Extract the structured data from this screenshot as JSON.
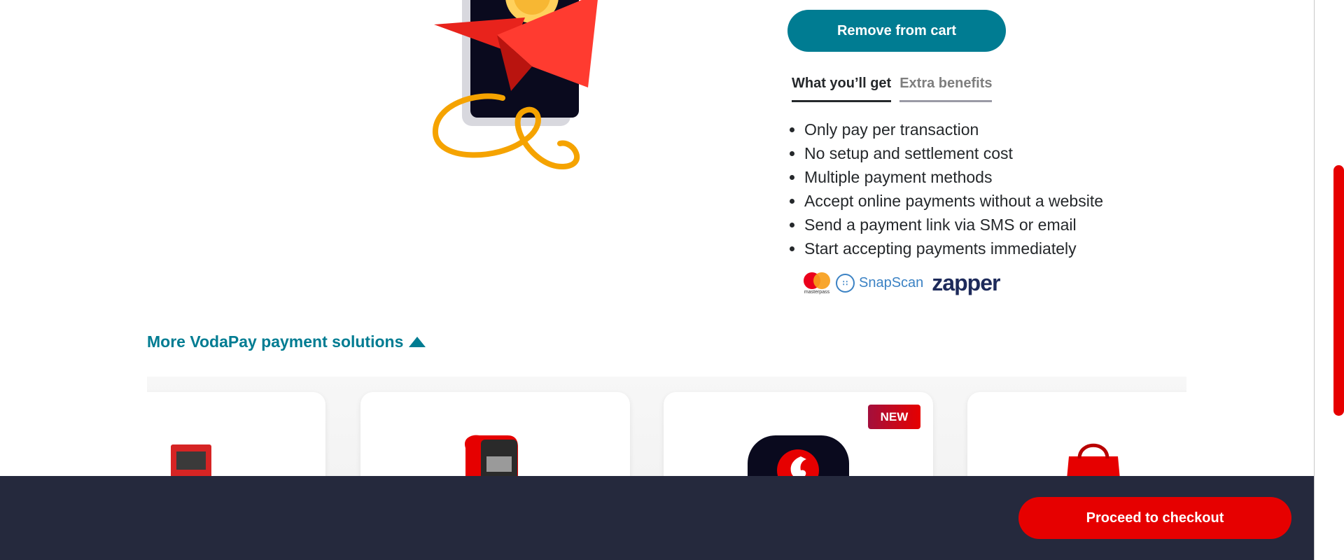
{
  "product": {
    "remove_label": "Remove from cart",
    "tabs": [
      {
        "label": "What you’ll get",
        "active": true
      },
      {
        "label": "Extra benefits",
        "active": false
      }
    ],
    "benefits": [
      "Only pay per transaction",
      "No setup and settlement cost",
      "Multiple payment methods",
      "Accept online payments without a website",
      "Send a payment link via SMS or email",
      "Start accepting payments immediately"
    ],
    "payment_logos": {
      "masterpass": "masterpass",
      "snapscan": "SnapScan",
      "zapper": "zapper"
    }
  },
  "more_solutions": {
    "label": "More VodaPay payment solutions",
    "badge_new": "NEW"
  },
  "footer": {
    "checkout_label": "Proceed to checkout"
  },
  "colors": {
    "teal": "#007c92",
    "red": "#e60000",
    "footer_bg": "#25293d"
  }
}
